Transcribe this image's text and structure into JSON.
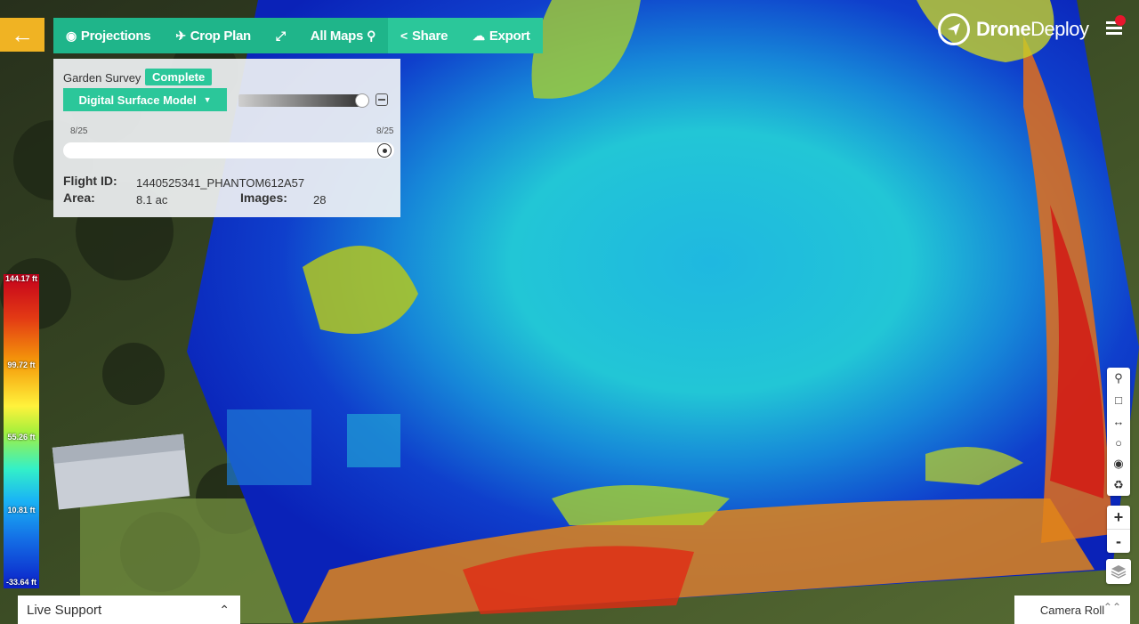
{
  "toolbar": {
    "back_icon": "arrow-left-icon",
    "items": [
      {
        "label": "Projections",
        "icon": "camera-icon"
      },
      {
        "label": "Crop Plan",
        "icon": "plane-icon"
      },
      {
        "label": "",
        "icon": "expand-icon"
      },
      {
        "label": "All Maps",
        "icon": "map-pin-icon"
      },
      {
        "label": "Share",
        "icon": "share-icon"
      },
      {
        "label": "Export",
        "icon": "cloud-download-icon"
      }
    ],
    "colors": {
      "primary": "#1fb58a",
      "accent": "#2bc79a",
      "back": "#f0b323"
    }
  },
  "brand": {
    "bold": "Drone",
    "regular": "Deploy",
    "notification_color": "#e8162d"
  },
  "panel": {
    "survey_name": "Garden Survey",
    "status": "Complete",
    "layer": "Digital Surface Model",
    "opacity_level": 0.95,
    "date_start": "8/25",
    "date_end": "8/25",
    "flight_id_label": "Flight ID:",
    "flight_id": "1440525341_PHANTOM612A57",
    "area_label": "Area:",
    "area": "8.1 ac",
    "images_label": "Images:",
    "images": "28"
  },
  "legend": {
    "max": "144.17 ft",
    "v1": "99.72 ft",
    "v2": "55.26 ft",
    "v3": "10.81 ft",
    "min": "-33.64 ft"
  },
  "tools": [
    "map-pin-icon",
    "square-icon",
    "measure-icon",
    "circle-icon",
    "eye-icon",
    "trash-icon"
  ],
  "zoom": {
    "in": "+",
    "out": "-"
  },
  "bottom": {
    "live_support": "Live Support",
    "camera_roll": "Camera Roll"
  }
}
